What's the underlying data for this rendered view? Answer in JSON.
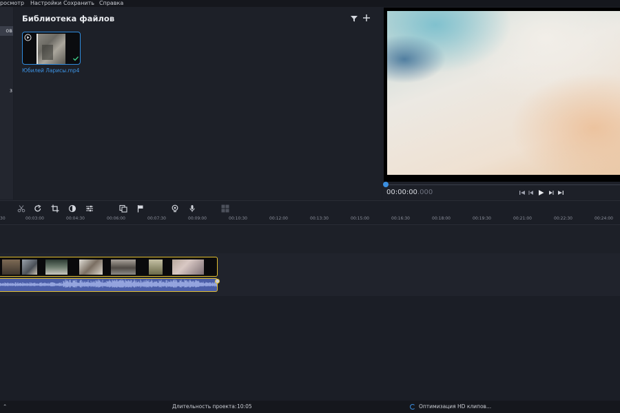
{
  "menu": {
    "items": [
      {
        "label": "росмотр"
      },
      {
        "label": "Настройки"
      },
      {
        "label": "Сохранить"
      },
      {
        "label": "Справка"
      }
    ]
  },
  "left_nav": {
    "items": [
      {
        "label": "ов",
        "active": true
      },
      {
        "label": "з",
        "active": false
      }
    ]
  },
  "library": {
    "title": "Библиотека файлов",
    "filter_icon": "filter-icon",
    "add_icon": "plus-icon",
    "files": [
      {
        "name": "Юбилей Ларисы.mp4",
        "selected": true,
        "icon": "play-circle-icon",
        "status_icon": "check-icon"
      }
    ]
  },
  "preview": {
    "timecode_main": "00:00:00",
    "timecode_ms": ".000",
    "controls": [
      "skip-start-icon",
      "prev-frame-icon",
      "play-icon",
      "next-frame-icon",
      "skip-end-icon"
    ]
  },
  "toolbar": {
    "tools": [
      "scissors-icon",
      "redo-icon",
      "crop-icon",
      "color-adjust-icon",
      "sliders-icon",
      "overlay-icon",
      "flag-icon",
      "record-video-icon",
      "microphone-icon",
      "grid-icon"
    ]
  },
  "ruler": {
    "labels": [
      "30",
      "00:03:00",
      "00:04:30",
      "00:06:00",
      "00:07:30",
      "00:09:00",
      "00:10:30",
      "00:12:00",
      "00:13:30",
      "00:15:00",
      "00:16:30",
      "00:18:00",
      "00:19:30",
      "00:21:00",
      "00:22:30",
      "00:24:00"
    ]
  },
  "timeline": {
    "clip_selected_color": "#e4c02f",
    "audio_color": "#4b5ea8"
  },
  "status": {
    "left_icon": "expand-icon",
    "duration_label": "Длительность проекта:",
    "duration_value": "10:05",
    "optimization_text": "Оптимизация HD клипов..."
  }
}
